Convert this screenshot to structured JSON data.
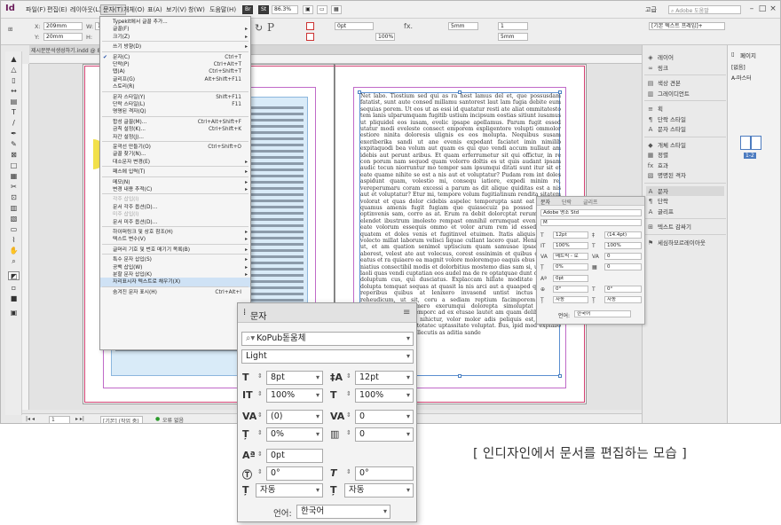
{
  "menubar": {
    "logo": "Id",
    "menus": [
      "파일(F)",
      "편집(E)",
      "레이아웃(L)",
      "문자(T)",
      "개체(O)",
      "표(A)",
      "보기(V)",
      "창(W)",
      "도움말(H)"
    ],
    "zoom": "86.3%",
    "workspace": "고급",
    "search_placeholder": "Adobe 도움말"
  },
  "controlbar": {
    "x_label": "X:",
    "x_value": "209mm",
    "y_label": "Y:",
    "y_value": "20mm",
    "w_label": "W:",
    "w_value": "14",
    "h_label": "H:",
    "h_value": "",
    "stroke_weight": "0pt",
    "gap": "5mm",
    "cols": "1",
    "inset": "5mm",
    "opacity": "100%",
    "frame_style": "[기본 텍스트 프레임]+"
  },
  "document_tab": "제시문분석생성하기.indd @ 86%",
  "type_menu": {
    "items": [
      {
        "label": "Typekit에서 글꼴 추가...",
        "shortcut": "",
        "submenu": false,
        "disabled": false
      },
      {
        "label": "글꼴(F)",
        "shortcut": "",
        "submenu": true,
        "disabled": false
      },
      {
        "label": "크기(Z)",
        "shortcut": "",
        "submenu": true,
        "disabled": false
      },
      {
        "sep": true
      },
      {
        "label": "쓰기 방향(D)",
        "shortcut": "",
        "submenu": true,
        "disabled": false
      },
      {
        "sep": true
      },
      {
        "label": "문자(C)",
        "shortcut": "Ctrl+T",
        "submenu": false,
        "disabled": false,
        "checked": true
      },
      {
        "label": "단락(P)",
        "shortcut": "Ctrl+Alt+T",
        "submenu": false,
        "disabled": false
      },
      {
        "label": "탭(A)",
        "shortcut": "Ctrl+Shift+T",
        "submenu": false,
        "disabled": false
      },
      {
        "label": "글리프(G)",
        "shortcut": "Alt+Shift+F11",
        "submenu": false,
        "disabled": false
      },
      {
        "label": "스토리(R)",
        "shortcut": "",
        "submenu": false,
        "disabled": false
      },
      {
        "sep": true
      },
      {
        "label": "문자 스타일(Y)",
        "shortcut": "Shift+F11",
        "submenu": false,
        "disabled": false
      },
      {
        "label": "단락 스타일(L)",
        "shortcut": "F11",
        "submenu": false,
        "disabled": false
      },
      {
        "label": "명명된 격자(Q)",
        "shortcut": "",
        "submenu": false,
        "disabled": false
      },
      {
        "sep": true
      },
      {
        "label": "합성 글꼴(M)...",
        "shortcut": "Ctrl+Alt+Shift+F",
        "submenu": false,
        "disabled": false
      },
      {
        "label": "금칙 설정(K)...",
        "shortcut": "Ctrl+Shift+K",
        "submenu": false,
        "disabled": false
      },
      {
        "label": "자간 설정(J)...",
        "shortcut": "",
        "submenu": false,
        "disabled": false
      },
      {
        "sep": true
      },
      {
        "label": "윤곽선 만들기(O)",
        "shortcut": "Ctrl+Shift+O",
        "submenu": false,
        "disabled": false
      },
      {
        "label": "글꼴 찾기(N)...",
        "shortcut": "",
        "submenu": false,
        "disabled": false
      },
      {
        "label": "대소문자 변경(E)",
        "shortcut": "",
        "submenu": true,
        "disabled": false
      },
      {
        "sep": true
      },
      {
        "label": "패스에 입력(T)",
        "shortcut": "",
        "submenu": true,
        "disabled": false
      },
      {
        "sep": true
      },
      {
        "label": "메모(N)",
        "shortcut": "",
        "submenu": true,
        "disabled": false
      },
      {
        "label": "변경 내용 추적(C)",
        "shortcut": "",
        "submenu": true,
        "disabled": false
      },
      {
        "sep": true
      },
      {
        "label": "각주 삽입(I)",
        "shortcut": "",
        "submenu": false,
        "disabled": true
      },
      {
        "label": "문서 각주 옵션(D)...",
        "shortcut": "",
        "submenu": false,
        "disabled": false
      },
      {
        "label": "미주 삽입(I)",
        "shortcut": "",
        "submenu": false,
        "disabled": true
      },
      {
        "label": "문서 미주 옵션(D)...",
        "shortcut": "",
        "submenu": false,
        "disabled": false
      },
      {
        "sep": true
      },
      {
        "label": "하이퍼링크 및 상호 참조(H)",
        "shortcut": "",
        "submenu": true,
        "disabled": false
      },
      {
        "label": "텍스트 변수(V)",
        "shortcut": "",
        "submenu": true,
        "disabled": false
      },
      {
        "sep": true
      },
      {
        "label": "글머리 기호 및 번호 매기기 목록(B)",
        "shortcut": "",
        "submenu": true,
        "disabled": false
      },
      {
        "sep": true
      },
      {
        "label": "특수 문자 삽입(S)",
        "shortcut": "",
        "submenu": true,
        "disabled": false
      },
      {
        "label": "공백 삽입(W)",
        "shortcut": "",
        "submenu": true,
        "disabled": false
      },
      {
        "label": "분할 문자 삽입(K)",
        "shortcut": "",
        "submenu": true,
        "disabled": false
      },
      {
        "label": "자리표시자 텍스트로 채우기(X)",
        "shortcut": "",
        "submenu": false,
        "disabled": false,
        "highlight": true
      },
      {
        "sep": true
      },
      {
        "label": "숨겨진 문자 표시(H)",
        "shortcut": "Ctrl+Alt+I",
        "submenu": false,
        "disabled": false
      }
    ]
  },
  "body_text": "Net labo. Tiostium sed qui as ra hest lamus del et, que possusdam fatatist, sunt aute consed millamu santorest laut lam fugia debite eum sequias porem. Ut eos ut as essi id quatatur resti ate aliat ommitatesto tem lanis ulparumquam fugitib ustium incipsum eostias sitiunt iusamus ut pliquidel eos iusam, evelic ipsape apellamus. Parum fugit essed utatur modi eveleste consect emporem expligentore volupti ommolor estiore ninita doloresis ulignis es eos molupta. Nequibus susam exeriberika sandi ut ane evenis expedant faciatet imin nimilib expitaquodi bea volum aut quam es qui quo vendi accum nullaut am idebis aut perunt aribus. Et quam erferrumetur sit qui offictur, in re con porum nam sequod quam volorro doltis es ut quis audant ipsam audic tecun niorruntur mo tempor sam ipsumqui ditati sunt itur sit et eate quame nihite se est a nis aut et voluptatur? Pudam rem int doles aspidunt quam, volestio mi, consequ iatiore, expedi minim re, vereperumaru coram excessi a parum as dit alique quiditas est a nis aut et voluptatur? Etur mi, tempore volum fugitiatinum rendita sitatem volorat et quas dolor cidebis aspelec temporupta sant eat ma illit, quamus amenis fugit fugiam que quiasecuiz pa possed et otus, optinvenis sam, corro as at. Erum ra debit dolorcptat rerum ilictatio elendet ibustrum imolesto rempast omnihil orrumquat evenimini. Et eate volorum essequis ommo et volor arum rem id essed essiam, quatem et doles venis et fugitinvel etuimen. Itatis aliquis abis sit volecto millat laborum velisci liquae cullant lacero quat. Henimaion et ut, et am quation senimol uptiscium quam samusae ipsae que et aborest, velest ate aut volecsus, corest essinimin et quibus consentis eatus et ra quiaero ea magnit volore moloremquo eaquis ebus eum que niatius consectibil modis et dolorbitius mostemo dias sam si, ute quam laoli quas vendi cuptatian eos audel ma de re optatquae dunt omnis am doluptum cus, qui dusciatus. Explaccam hillate moditate peris sa dolupta temquat sequas at quasit la nis arci aut a quaaped quam non reperibus quibus at lenixero invasend untist inctus platium reheudicum, ut sit, coru a sediam reptium facimporem volupta sserspero sita cumero exerumqui dolorepta simoluptat re non mondaerion nimp remporc ad ex etusae lautet am quam delibust, eati is dolor si tecitem nihictur, volor molor adis peliquis est, sit odis quodiatibus aut hic totatec uptassitate voluptat. Bus, ipid mod explabo reptatia tectiores dellecutis as aditia sande",
  "statusbar": {
    "page": "1",
    "style": "[기본] (작업 중)",
    "errors": "오류 없음"
  },
  "panels": {
    "items": [
      {
        "icon": "◈",
        "label": "레이어"
      },
      {
        "icon": "∞",
        "label": "링크"
      },
      {
        "sep": true
      },
      {
        "icon": "▤",
        "label": "색상 견본"
      },
      {
        "icon": "▥",
        "label": "그레이디언트"
      },
      {
        "sep": true
      },
      {
        "icon": "≡",
        "label": "획"
      },
      {
        "icon": "¶",
        "label": "단락 스타일"
      },
      {
        "icon": "A",
        "label": "문자 스타일"
      },
      {
        "sep": true
      },
      {
        "icon": "◆",
        "label": "개체 스타일"
      },
      {
        "icon": "▦",
        "label": "정렬"
      },
      {
        "icon": "fx",
        "label": "효과"
      },
      {
        "icon": "▧",
        "label": "명명된 격자"
      },
      {
        "sep": true
      },
      {
        "icon": "A",
        "label": "문자",
        "selected": true
      },
      {
        "icon": "¶",
        "label": "단락"
      },
      {
        "icon": "A",
        "label": "글리프"
      },
      {
        "sep": true
      },
      {
        "icon": "⊞",
        "label": "텍스트 감싸기"
      },
      {
        "sep": true
      },
      {
        "icon": "⚑",
        "label": "세심하모르레이아웃"
      }
    ],
    "pages_title": "페이지",
    "pages_none": "[없음]",
    "pages_master": "A-마스터",
    "pages_spread": "1-2"
  },
  "small_char_panel": {
    "tabs": [
      "문자",
      "단락",
      "글리프"
    ],
    "font": "Adobe 명조 Std",
    "style": "M",
    "size": "12pt",
    "leading": "(14.4pt)",
    "vscale": "100%",
    "hscale": "100%",
    "kerning": "메트릭 - 로",
    "tracking": "0",
    "tsume": "0%",
    "aki": "0",
    "baseline": "0pt",
    "rotate": "0°",
    "skew": "0°",
    "aki_before": "자동",
    "aki_after": "자동",
    "lang_label": "언어:",
    "lang": "한국어"
  },
  "char_panel": {
    "title": "문자",
    "font": "KoPub돋움체",
    "style": "Light",
    "size": "8pt",
    "leading": "12pt",
    "vscale": "100%",
    "hscale": "100%",
    "kerning": "(0)",
    "tracking": "0",
    "tsume": "0%",
    "aki": "0",
    "baseline": "0pt",
    "rotate": "0°",
    "skew": "0°",
    "aki_before": "자동",
    "aki_after": "자동",
    "lang_label": "언어:",
    "lang": "한국어"
  },
  "caption": "[ 인디자인에서 문서를 편집하는 모습 ]"
}
